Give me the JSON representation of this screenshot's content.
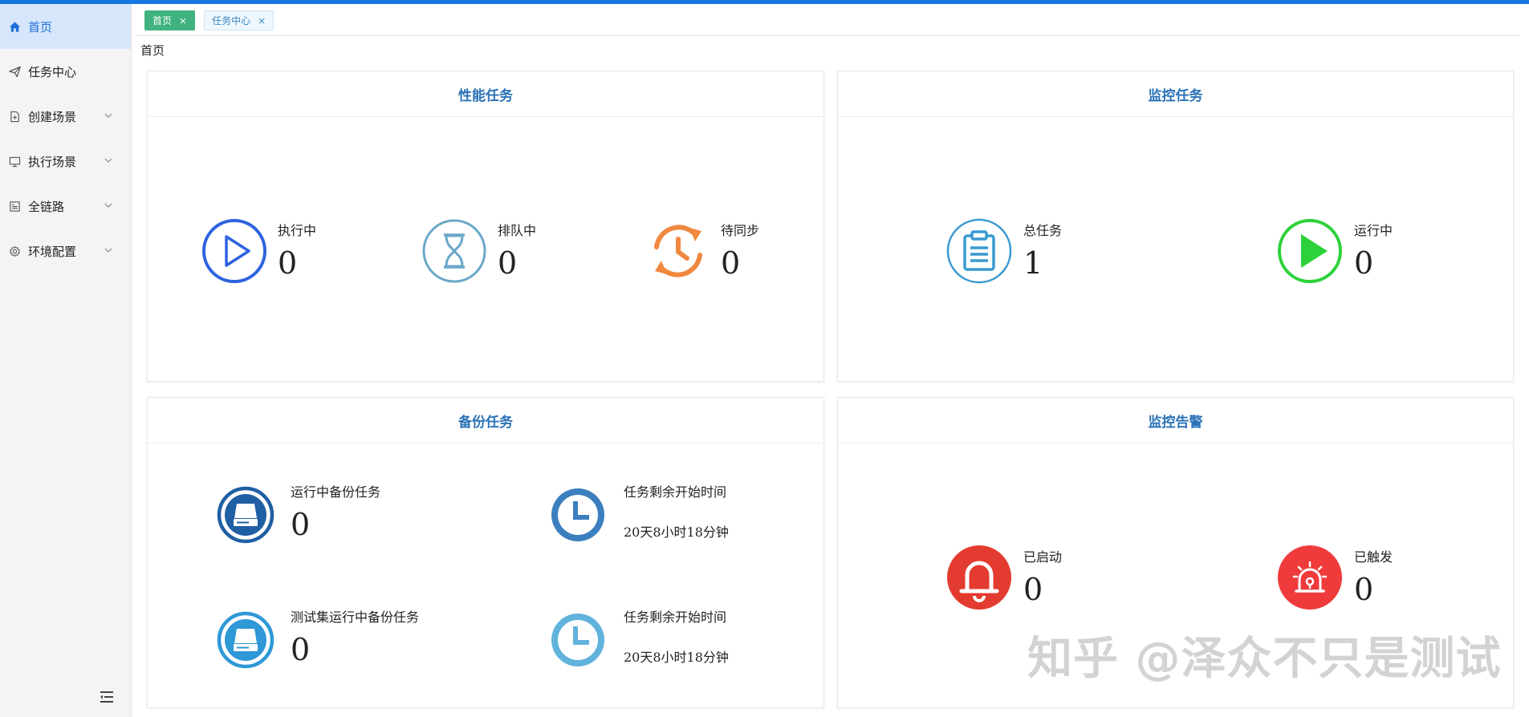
{
  "colors": {
    "accent": "#1677e0",
    "active_tab": "#3fb27f",
    "card_title": "#2a72b6",
    "alarm_red": "#e33b2f",
    "running_green": "#2dd23a",
    "sync_orange": "#f08840"
  },
  "sidebar": {
    "items": [
      {
        "label": "首页",
        "icon": "home-icon"
      },
      {
        "label": "任务中心",
        "icon": "send-icon"
      },
      {
        "label": "创建场景",
        "icon": "file-add-icon"
      },
      {
        "label": "执行场景",
        "icon": "monitor-icon"
      },
      {
        "label": "全链路",
        "icon": "form-icon"
      },
      {
        "label": "环境配置",
        "icon": "gear-icon"
      }
    ],
    "collapse_icon": "collapse-menu-icon"
  },
  "tabs": [
    {
      "label": "首页",
      "close": "×"
    },
    {
      "label": "任务中心",
      "close": "×"
    }
  ],
  "breadcrumb": "首页",
  "perf": {
    "title": "性能任务",
    "running_label": "执行中",
    "running_value": "0",
    "queued_label": "排队中",
    "queued_value": "0",
    "sync_label": "待同步",
    "sync_value": "0"
  },
  "monitor": {
    "title": "监控任务",
    "total_label": "总任务",
    "total_value": "1",
    "running_label": "运行中",
    "running_value": "0"
  },
  "backup": {
    "title": "备份任务",
    "running_label": "运行中备份任务",
    "running_value": "0",
    "remaining1_label": "任务剩余开始时间",
    "remaining1_value": "20天8小时18分钟",
    "suite_label": "测试集运行中备份任务",
    "suite_value": "0",
    "remaining2_label": "任务剩余开始时间",
    "remaining2_value": "20天8小时18分钟"
  },
  "alerts": {
    "title": "监控告警",
    "enabled_label": "已启动",
    "enabled_value": "0",
    "triggered_label": "已触发",
    "triggered_value": "0"
  },
  "watermark": "知乎 @泽众不只是测试"
}
